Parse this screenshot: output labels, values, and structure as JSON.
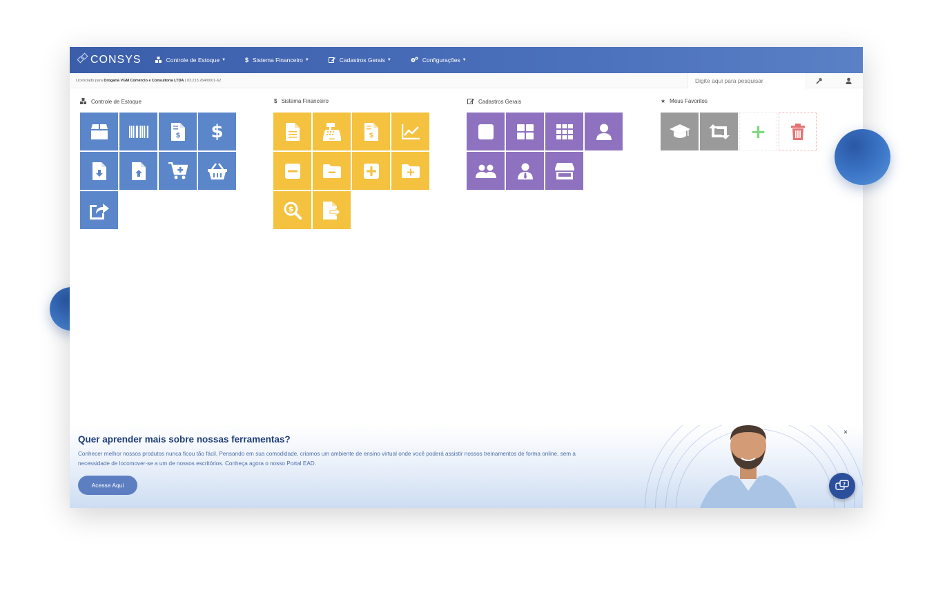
{
  "brand": {
    "logo_text": "CONSYS"
  },
  "nav": {
    "items": [
      {
        "label": "Controle de Estoque",
        "icon": "cubes-icon"
      },
      {
        "label": "Sistema Financeiro",
        "icon": "dollar-icon"
      },
      {
        "label": "Cadastros Gerais",
        "icon": "edit-icon"
      },
      {
        "label": "Configurações",
        "icon": "gears-icon"
      }
    ]
  },
  "subbar": {
    "license_prefix": "Licenciado para ",
    "license_company": "Drogaria VGM Comércio e Consultoria LTDA",
    "license_suffix": " | 03.215.264/0001-62",
    "search_placeholder": "Digite aqui para pesquisar"
  },
  "sections": {
    "estoque": {
      "title": "Controle de Estoque"
    },
    "financeiro": {
      "title": "Sistema Financeiro"
    },
    "cadastros": {
      "title": "Cadastros Gerais"
    },
    "favoritos": {
      "title": "Meus Favoritos"
    }
  },
  "banner": {
    "title": "Quer aprender mais sobre nossas ferramentas?",
    "text": "Conhecer melhor nossos produtos nunca ficou tão fácil. Pensando em sua comodidade, criamos um ambiente de ensino virtual onde você poderá assistir nossos treinamentos de forma online, sem a necessidade de locomover-se a um de nossos escritórios. Conheça agora o nosso Portal EAD.",
    "button_label": "Acesse Aqui",
    "close_label": "×"
  },
  "colors": {
    "topbar": "#4a6fbb",
    "estoque_tile": "#5b86ca",
    "financeiro_tile": "#f4c23f",
    "cadastros_tile": "#8e72bf",
    "favoritos_tile": "#9a9a9a"
  }
}
